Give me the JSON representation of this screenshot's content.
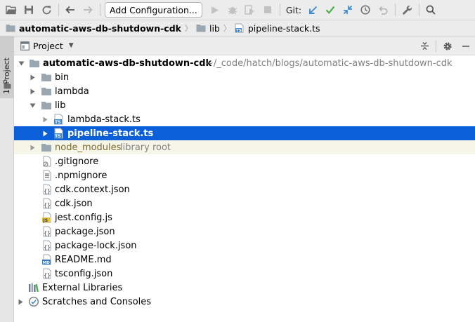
{
  "toolbar": {
    "configuration_label": "Add Configuration...",
    "git_label": "Git:"
  },
  "breadcrumb": {
    "items": [
      "automatic-aws-db-shutdown-cdk",
      "lib",
      "pipeline-stack.ts"
    ]
  },
  "sidestrip": {
    "tab_label": "1: Project"
  },
  "panel": {
    "title": "Project"
  },
  "tree": {
    "root": {
      "name": "automatic-aws-db-shutdown-cdk",
      "path": "~/_code/hatch/blogs/automatic-aws-db-shutdown-cdk"
    },
    "items": [
      {
        "name": "bin"
      },
      {
        "name": "lambda"
      },
      {
        "name": "lib"
      },
      {
        "name": "lambda-stack.ts"
      },
      {
        "name": "pipeline-stack.ts"
      },
      {
        "name": "node_modules",
        "hint": "library root"
      },
      {
        "name": ".gitignore"
      },
      {
        "name": ".npmignore"
      },
      {
        "name": "cdk.context.json"
      },
      {
        "name": "cdk.json"
      },
      {
        "name": "jest.config.js"
      },
      {
        "name": "package.json"
      },
      {
        "name": "package-lock.json"
      },
      {
        "name": "README.md"
      },
      {
        "name": "tsconfig.json"
      },
      {
        "name": "External Libraries"
      },
      {
        "name": "Scratches and Consoles"
      }
    ]
  },
  "colors": {
    "selection": "#0b5fd8",
    "folder": "#9aa7b0",
    "git_update": "#3a8ad6",
    "git_commit": "#4caf50"
  }
}
